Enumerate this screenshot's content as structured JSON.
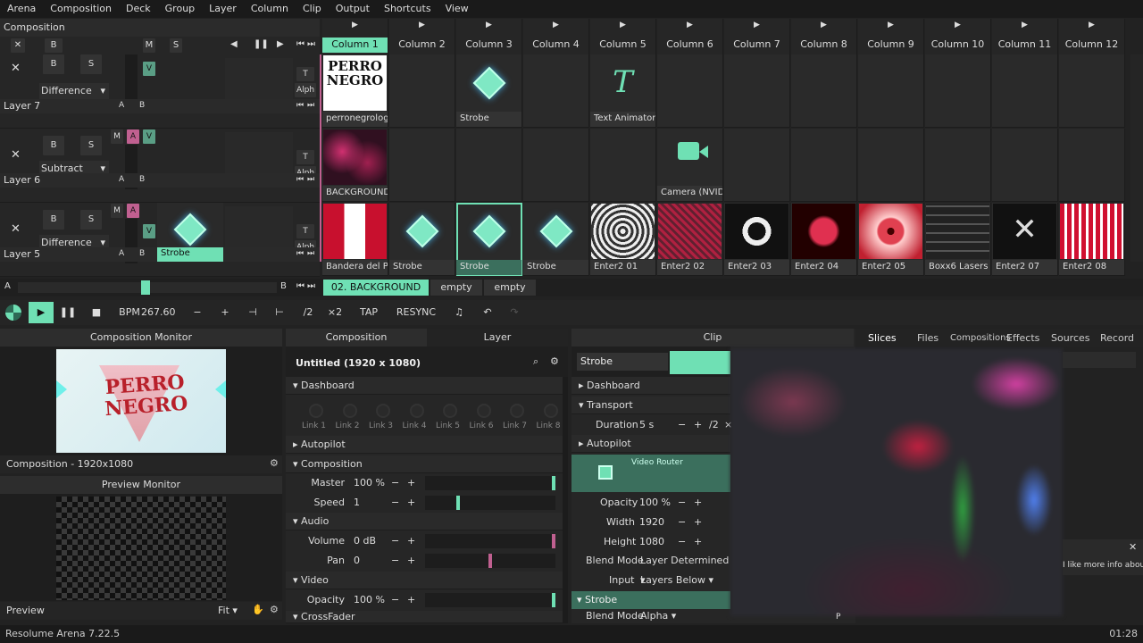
{
  "menu": [
    "Arena",
    "Composition",
    "Deck",
    "Group",
    "Layer",
    "Column",
    "Clip",
    "Output",
    "Shortcuts",
    "View"
  ],
  "composition_title": "Composition",
  "columns": [
    {
      "label": "Column 1",
      "selected": true
    },
    {
      "label": "Column 2"
    },
    {
      "label": "Column 3"
    },
    {
      "label": "Column 4"
    },
    {
      "label": "Column 5"
    },
    {
      "label": "Column 6"
    },
    {
      "label": "Column 7"
    },
    {
      "label": "Column 8"
    },
    {
      "label": "Column 9"
    },
    {
      "label": "Column 10"
    },
    {
      "label": "Column 11"
    },
    {
      "label": "Column 12"
    }
  ],
  "master_row": {
    "b": "B",
    "m": "M",
    "s": "S"
  },
  "layers": [
    {
      "name": "Layer 7",
      "blend": "Difference",
      "b": "B",
      "s": "S",
      "m": "M",
      "a": "A",
      "v": "V",
      "t": "T",
      "alph": "Alph",
      "ab_a": "A",
      "ab_b": "B",
      "clips": [
        {
          "col": 0,
          "label": "perronegrologo",
          "thumb": "perro"
        },
        {
          "col": 2,
          "label": "Strobe",
          "thumb": "strobe"
        },
        {
          "col": 4,
          "label": "Text Animator",
          "thumb": "text"
        }
      ]
    },
    {
      "name": "Layer 6",
      "blend": "Subtract",
      "b": "B",
      "s": "S",
      "m": "M",
      "a": "A",
      "v": "V",
      "t": "T",
      "alph": "Alph",
      "ab_a": "A",
      "ab_b": "B",
      "clips": [
        {
          "col": 0,
          "label": "BACKGROUND 03",
          "thumb": "bg"
        },
        {
          "col": 5,
          "label": "Camera (NVIDIA B...",
          "thumb": "camera"
        }
      ]
    },
    {
      "name": "Layer 5",
      "blend": "Difference",
      "b": "B",
      "s": "S",
      "m": "M",
      "a": "A",
      "v": "V",
      "t": "T",
      "alph": "Alph",
      "ab_a": "A",
      "ab_b": "B",
      "active_clip": "Strobe",
      "clips": [
        {
          "col": 0,
          "label": "Bandera del Perú...",
          "thumb": "flag"
        },
        {
          "col": 1,
          "label": "Strobe",
          "thumb": "strobe"
        },
        {
          "col": 2,
          "label": "Strobe",
          "thumb": "strobe",
          "selected": true
        },
        {
          "col": 3,
          "label": "Strobe",
          "thumb": "strobe"
        },
        {
          "col": 4,
          "label": "Enter2 01",
          "thumb": "spiral"
        },
        {
          "col": 5,
          "label": "Enter2 02",
          "thumb": "pink"
        },
        {
          "col": 6,
          "label": "Enter2 03",
          "thumb": "ring"
        },
        {
          "col": 7,
          "label": "Enter2 04",
          "thumb": "redball"
        },
        {
          "col": 8,
          "label": "Enter2 05",
          "thumb": "redring"
        },
        {
          "col": 9,
          "label": "Boxx6 Lasers",
          "thumb": "lasers"
        },
        {
          "col": 10,
          "label": "Enter2 07",
          "thumb": "cross"
        },
        {
          "col": 11,
          "label": "Enter2 08",
          "thumb": "stripes"
        }
      ]
    }
  ],
  "deck_bar": {
    "a": "A",
    "b": "B",
    "decks": [
      {
        "label": "02. BACKGROUND",
        "active": true
      },
      {
        "label": "empty"
      },
      {
        "label": "empty"
      }
    ]
  },
  "transport": {
    "bpm_label": "BPM",
    "bpm": "267.60",
    "minus": "−",
    "plus": "+",
    "half": "/2",
    "double": "×2",
    "tap": "TAP",
    "resync": "RESYNC"
  },
  "comp_monitor": {
    "title": "Composition Monitor",
    "caption": "Composition - 1920x1080",
    "logo_top": "PERRO",
    "logo_bottom": "NEGRO"
  },
  "preview_monitor": {
    "title": "Preview Monitor",
    "caption": "Preview",
    "fit": "Fit"
  },
  "comp_panel": {
    "tab1": "Composition",
    "tab2": "Layer",
    "title": "Untitled (1920 x 1080)",
    "dashboard": "Dashboard",
    "links": [
      "Link 1",
      "Link 2",
      "Link 3",
      "Link 4",
      "Link 5",
      "Link 6",
      "Link 7",
      "Link 8"
    ],
    "autopilot": "Autopilot",
    "composition": "Composition",
    "master_label": "Master",
    "master_val": "100 %",
    "speed_label": "Speed",
    "speed_val": "1",
    "audio": "Audio",
    "volume_label": "Volume",
    "volume_val": "0 dB",
    "pan_label": "Pan",
    "pan_val": "0",
    "video": "Video",
    "opacity_label": "Opacity",
    "opacity_val": "100 %",
    "crossfader": "CrossFader"
  },
  "clip_panel": {
    "tab": "Clip",
    "name": "Strobe",
    "dashboard": "Dashboard",
    "transport": "Transport",
    "duration_label": "Duration",
    "duration_val": "5 s",
    "half": "/2",
    "times": "×",
    "autopilot": "Autopilot",
    "router": "Video Router",
    "opacity_label": "Opacity",
    "opacity_val": "100 %",
    "width_label": "Width",
    "width_val": "1920",
    "height_label": "Height",
    "height_val": "1080",
    "blend_label": "Blend Mode",
    "blend_val": "Layer Determined",
    "input_label": "Input",
    "input_val": "Layers Below",
    "strobe": "Strobe",
    "blend2_label": "Blend Mode",
    "blend2_val": "Alpha",
    "p": "P"
  },
  "right_tabs": [
    "Slices",
    "Files",
    "Compositions",
    "Effects",
    "Sources",
    "Record"
  ],
  "notice": "I like more info about.",
  "status": {
    "left": "Resolume Arena 7.22.5",
    "right": "01:28"
  },
  "colors": {
    "accent": "#6fe0b4",
    "pink": "#c06090"
  }
}
